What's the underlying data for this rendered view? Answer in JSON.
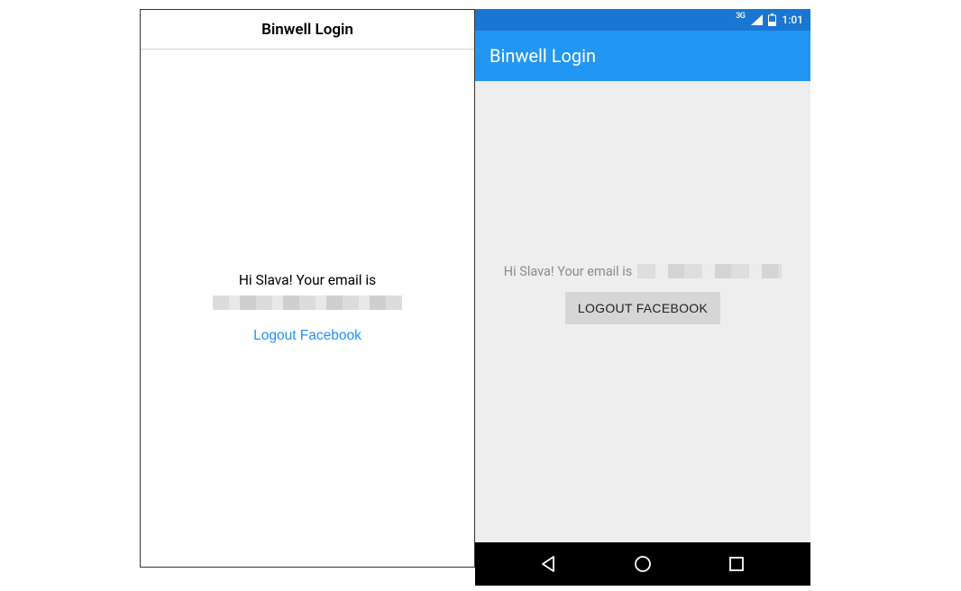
{
  "ios": {
    "title": "Binwell Login",
    "greeting": "Hi Slava! Your email is",
    "logout_label": "Logout Facebook"
  },
  "android": {
    "statusbar": {
      "network_type": "3G",
      "time": "1:01"
    },
    "title": "Binwell Login",
    "greeting": "Hi Slava! Your email is",
    "logout_label": "LOGOUT FACEBOOK"
  }
}
